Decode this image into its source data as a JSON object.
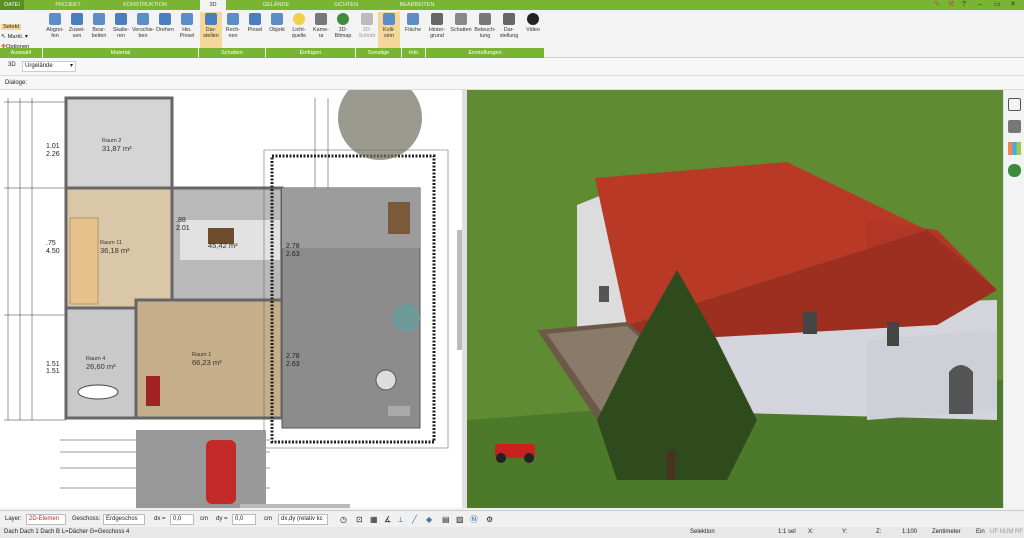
{
  "tabs": [
    "DATEI",
    "PROJEKT",
    "KONSTRUKTION",
    "3D",
    "GELÄNDE",
    "SICHTEN",
    "BEARBEITEN"
  ],
  "active_tab": "3D",
  "ribbon": {
    "left": {
      "select": "Selekt",
      "mark": "Markl.",
      "options": "Optionen",
      "group": "Auswahl"
    },
    "material": {
      "group": "Material",
      "buttons": [
        "Abgrei-\nfen",
        "Zuwei-\nsen",
        "Bear-\nbeiten",
        "Skalie-\nren",
        "Verschie-\nben",
        "Drehen",
        "Hin.\nPinsel"
      ]
    },
    "schatten": {
      "group": "Schatten",
      "buttons": [
        "Dar-\nstellen",
        "Rech-\nnen",
        "Pinsel"
      ]
    },
    "einfuegen": {
      "group": "Einfügen",
      "buttons": [
        "Objekt",
        "Licht-\nquelle",
        "Kame-\nra",
        "3D-\nBitmap"
      ]
    },
    "sonstige": {
      "group": "Sonstige",
      "buttons": [
        "3D-\nSchnitt",
        "Kolli-\nsion"
      ]
    },
    "info": {
      "group": "Info",
      "buttons": [
        "Fläche"
      ]
    },
    "einstellungen": {
      "group": "Einstellungen",
      "buttons": [
        "Hinter-\ngrund",
        "Schatten",
        "Beleuch-\ntung",
        "Dar-\nstellung",
        "Video"
      ]
    }
  },
  "toolbar2": {
    "mode": "3D",
    "terrain": "Urgelände"
  },
  "dialog_label": "Dialoge:",
  "plan": {
    "rooms": [
      {
        "name": "Raum 2",
        "area": "31,87 m²"
      },
      {
        "name": "Raum 11",
        "area": "36,18 m²"
      },
      {
        "name": "Raum 4",
        "area": "26,60 m²"
      },
      {
        "name": "Raum 1",
        "area": "66,23 m²"
      },
      {
        "name": "",
        "area": "45,42 m²"
      }
    ],
    "dims": [
      "1.01",
      "2.26",
      ".75",
      "4.50",
      "1.51",
      "1.51",
      "2.78",
      "2.63",
      "2.78",
      "2.63",
      ".88",
      "2.01"
    ]
  },
  "statusbar": {
    "layer_label": "Layer:",
    "layer_value": "2D-Elemen",
    "geschoss_label": "Geschoss:",
    "geschoss_value": "Erdgeschos",
    "dx_label": "dx =",
    "dx_value": "0,0",
    "dy_label": "dy =",
    "dy_value": "0,0",
    "unit1": "cm",
    "unit2": "cm",
    "mode": "dx,dy (relativ kc"
  },
  "bottombar": {
    "left": "Dach Dach 1 Dach B L=Dächer G=Geschoss 4",
    "selection": "Selektion",
    "sel_count": "1:1 sel",
    "x": "X:",
    "y": "Y:",
    "z": "Z:",
    "scale": "1:100",
    "unit": "Zentimeter",
    "ein": "Ein",
    "flags": "UF NUM RF"
  },
  "colors": {
    "accent": "#79b433",
    "roof": "#b83a26",
    "grass": "#5d8a30"
  }
}
